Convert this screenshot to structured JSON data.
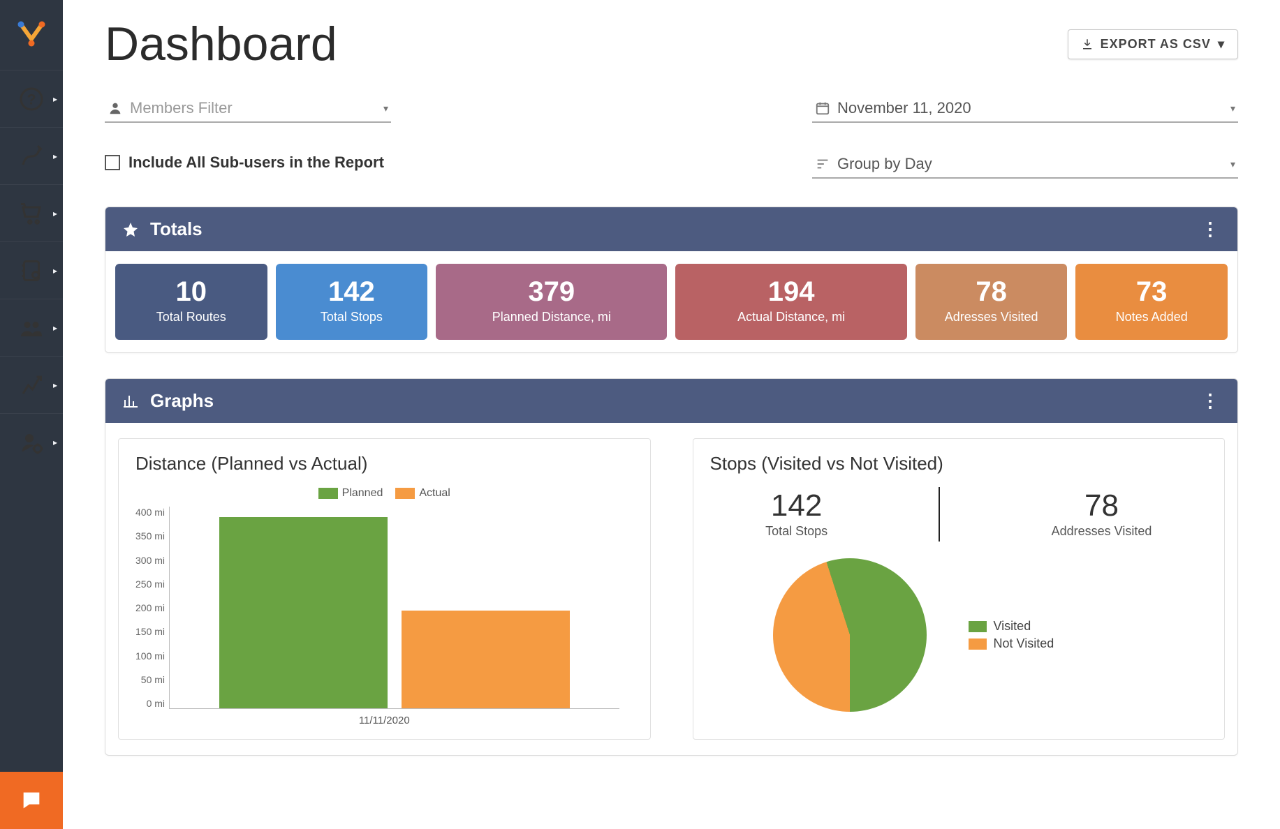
{
  "title": "Dashboard",
  "export_label": "EXPORT AS CSV",
  "filters": {
    "members_placeholder": "Members Filter",
    "date_value": "November 11, 2020",
    "include_sub": "Include All Sub-users in the Report",
    "group_by": "Group by Day"
  },
  "totals_header": "Totals",
  "totals": [
    {
      "value": "10",
      "label": "Total Routes"
    },
    {
      "value": "142",
      "label": "Total Stops"
    },
    {
      "value": "379",
      "label": "Planned Distance, mi"
    },
    {
      "value": "194",
      "label": "Actual Distance, mi"
    },
    {
      "value": "78",
      "label": "Adresses Visited"
    },
    {
      "value": "73",
      "label": "Notes Added"
    }
  ],
  "graphs_header": "Graphs",
  "bar_chart": {
    "title": "Distance (Planned vs Actual)",
    "legend_planned": "Planned",
    "legend_actual": "Actual",
    "x_label": "11/11/2020",
    "y_ticks": [
      "400 mi",
      "350 mi",
      "300 mi",
      "250 mi",
      "200 mi",
      "150 mi",
      "100 mi",
      "50 mi",
      "0 mi"
    ]
  },
  "stops_chart": {
    "title": "Stops (Visited vs Not Visited)",
    "total_stops_value": "142",
    "total_stops_label": "Total Stops",
    "visited_value": "78",
    "visited_label": "Addresses Visited",
    "legend_visited": "Visited",
    "legend_not_visited": "Not Visited"
  },
  "chart_data": [
    {
      "type": "bar",
      "title": "Distance (Planned vs Actual)",
      "categories": [
        "11/11/2020"
      ],
      "series": [
        {
          "name": "Planned",
          "values": [
            379
          ],
          "color": "#6aa342"
        },
        {
          "name": "Actual",
          "values": [
            194
          ],
          "color": "#f59b42"
        }
      ],
      "ylabel": "mi",
      "ylim": [
        0,
        400
      ],
      "y_tick_step": 50
    },
    {
      "type": "pie",
      "title": "Stops (Visited vs Not Visited)",
      "series": [
        {
          "name": "Visited",
          "value": 78,
          "color": "#6aa342"
        },
        {
          "name": "Not Visited",
          "value": 64,
          "color": "#f59b42"
        }
      ],
      "total": 142
    }
  ],
  "colors": {
    "green": "#6aa342",
    "orange": "#f59b42"
  }
}
